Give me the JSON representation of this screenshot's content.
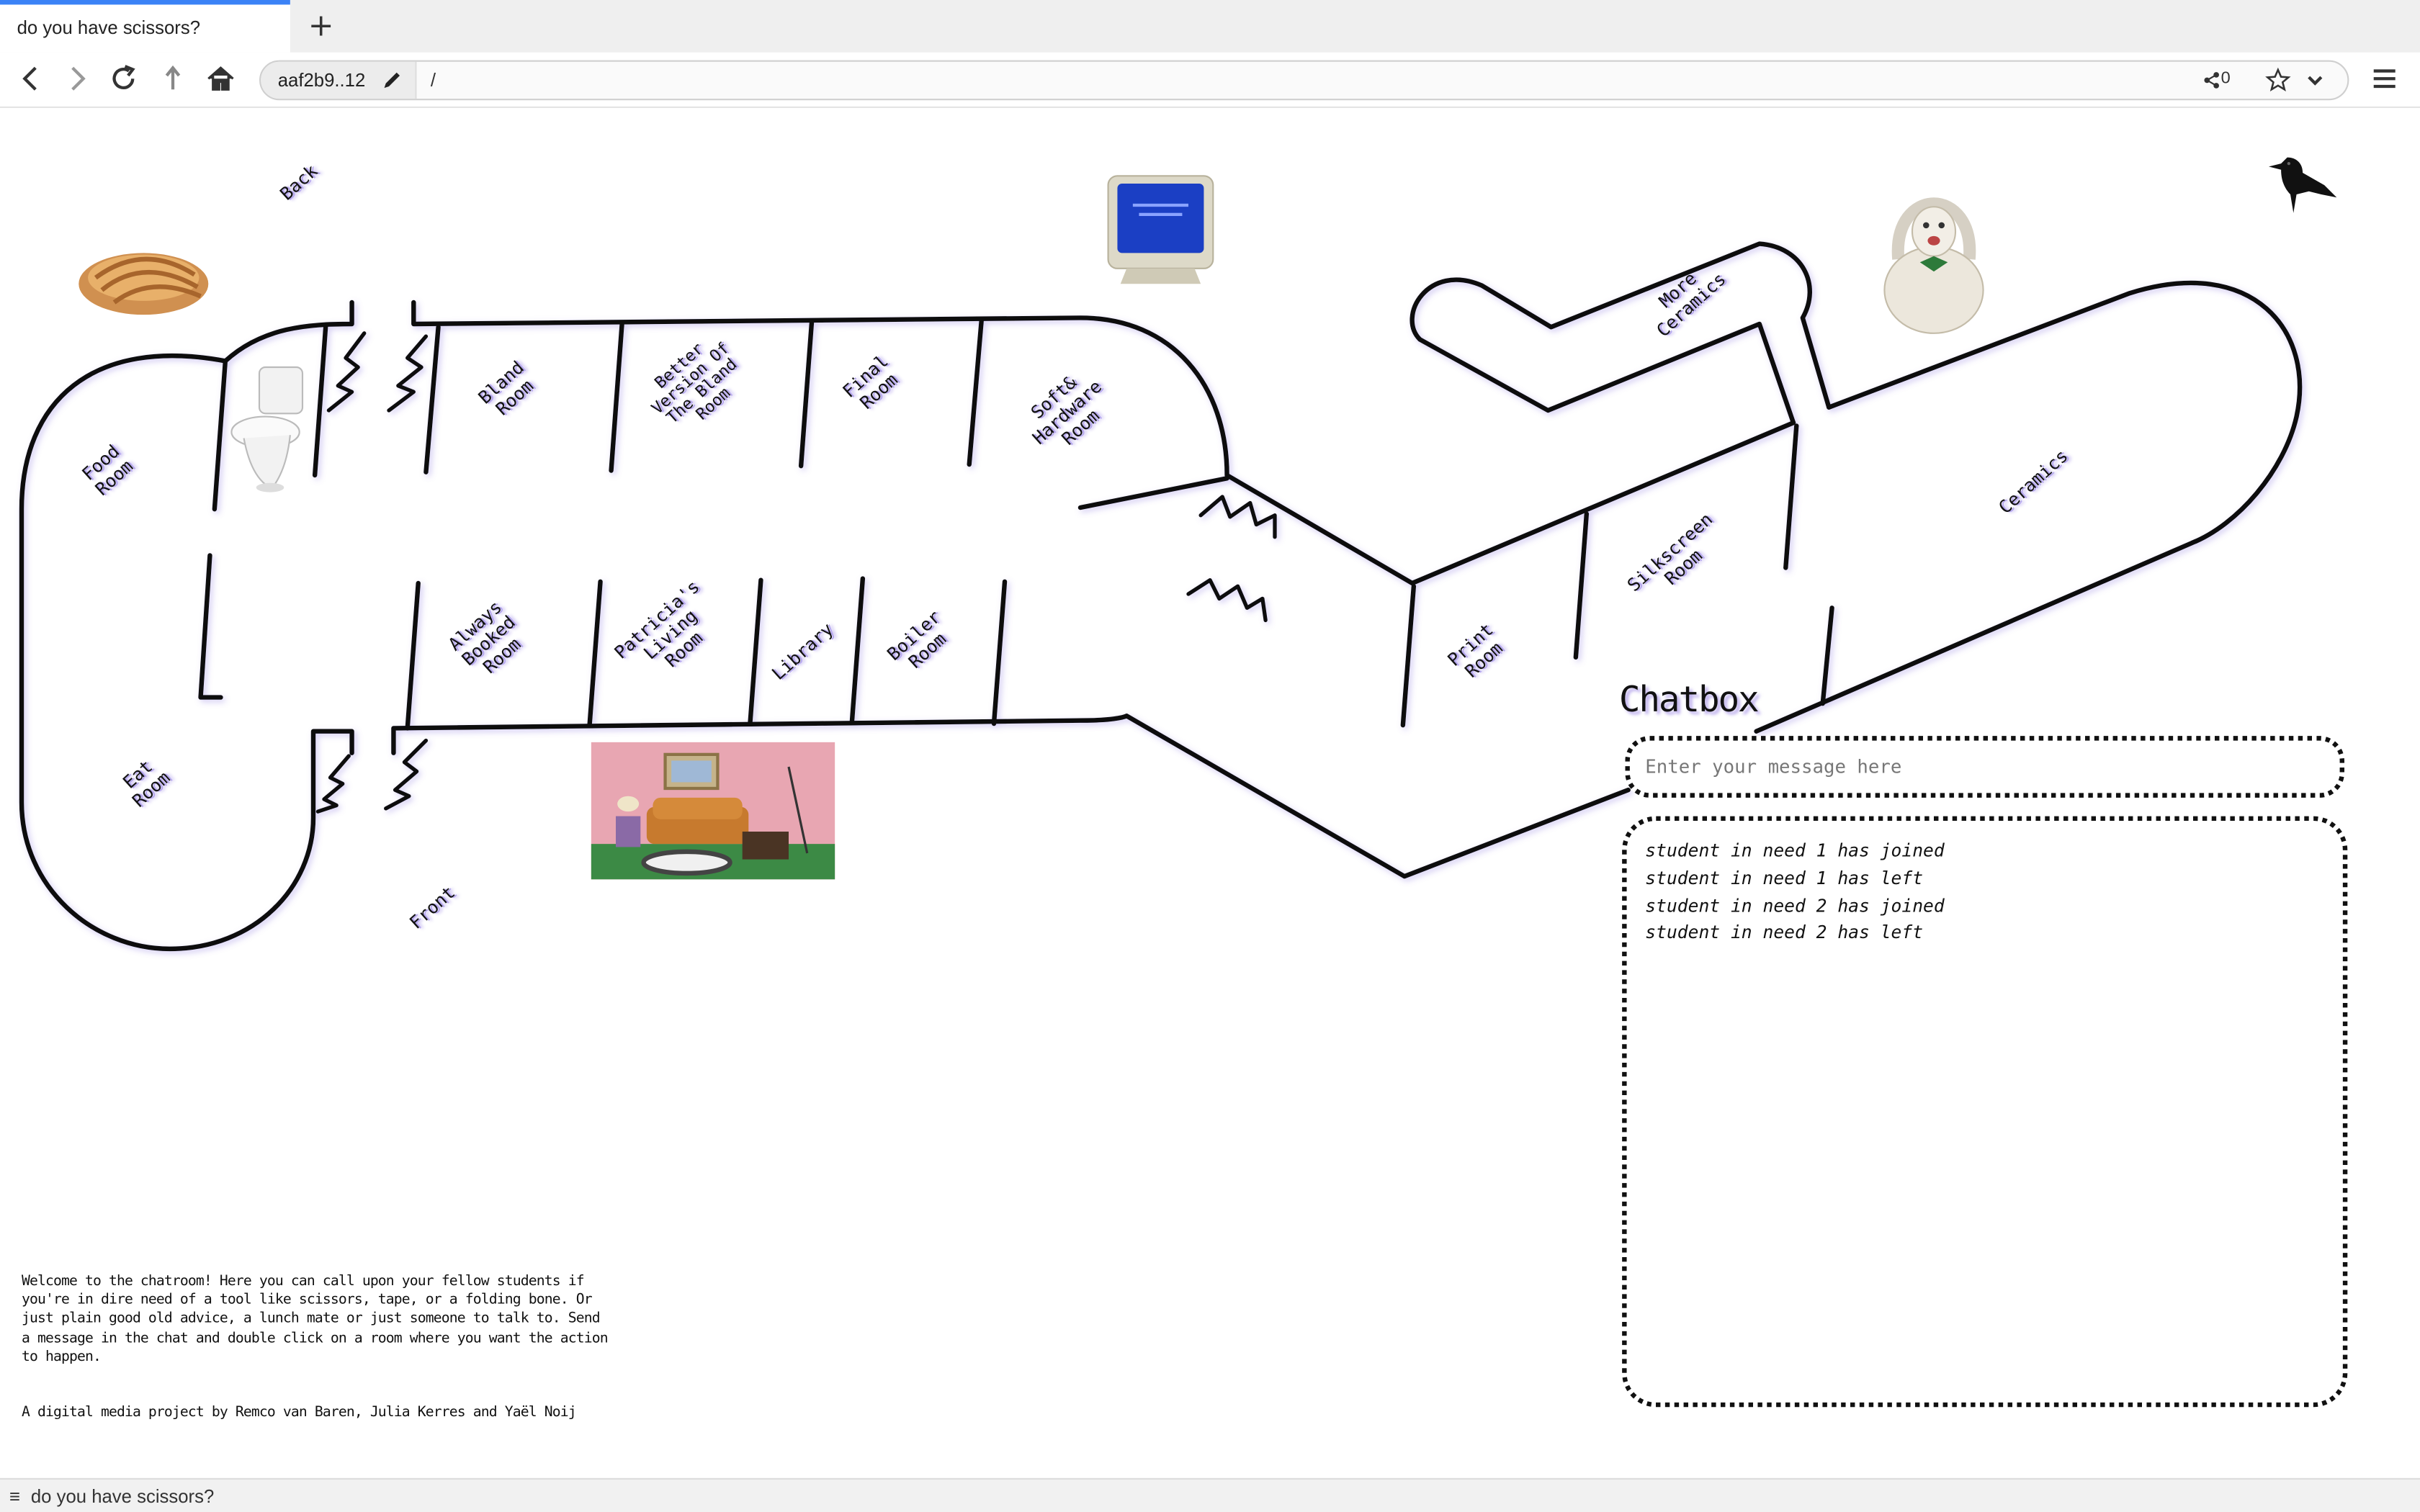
{
  "browser": {
    "tab_title": "do you have scissors?",
    "new_tab_symbol": "+",
    "url_host": "aaf2b9..12",
    "url_path": "/",
    "share_count": "0",
    "status_title": "do you have scissors?"
  },
  "map": {
    "back_label": "Back",
    "front_label": "Front",
    "rooms": [
      {
        "id": "food",
        "label": "Food\nRoom"
      },
      {
        "id": "bland",
        "label": "Bland\nRoom"
      },
      {
        "id": "better-bland",
        "label": "Better\nVersion Of\nThe Bland\nRoom"
      },
      {
        "id": "final",
        "label": "Final\nRoom"
      },
      {
        "id": "soft-hardware",
        "label": "Soft&\nHardware\nRoom"
      },
      {
        "id": "more-ceramics",
        "label": "More\nCeramics"
      },
      {
        "id": "ceramics",
        "label": "Ceramics"
      },
      {
        "id": "always-booked",
        "label": "Always\nBooked\nRoom"
      },
      {
        "id": "patricias-living",
        "label": "Patricia's\nLiving\nRoom"
      },
      {
        "id": "library",
        "label": "Library"
      },
      {
        "id": "boiler",
        "label": "Boiler\nRoom"
      },
      {
        "id": "print",
        "label": "Print\nRoom"
      },
      {
        "id": "silkscreen",
        "label": "Silkscreen\nRoom"
      },
      {
        "id": "eat",
        "label": "Eat\nRoom"
      }
    ],
    "icons": [
      "pastry-image",
      "toilet-image",
      "crt-monitor-image",
      "ceramic-dog-basket-image",
      "crow-image",
      "living-room-image"
    ]
  },
  "chat": {
    "title": "Chatbox",
    "placeholder": "Enter your message here",
    "messages": [
      "student in need 1 has joined",
      "student in need 1 has left",
      "student in need 2 has joined",
      "student in need 2 has left"
    ]
  },
  "footer": {
    "intro": "Welcome to the chatroom! Here you can call upon your fellow students if you're in dire need of a tool like scissors, tape, or a folding bone. Or just plain good old advice, a lunch mate or just someone to talk to. Send a message in the chat and double click on a room where you want the action to happen.",
    "credits": "A digital media project by Remco van Baren, Julia Kerres and Yaël Noij"
  }
}
